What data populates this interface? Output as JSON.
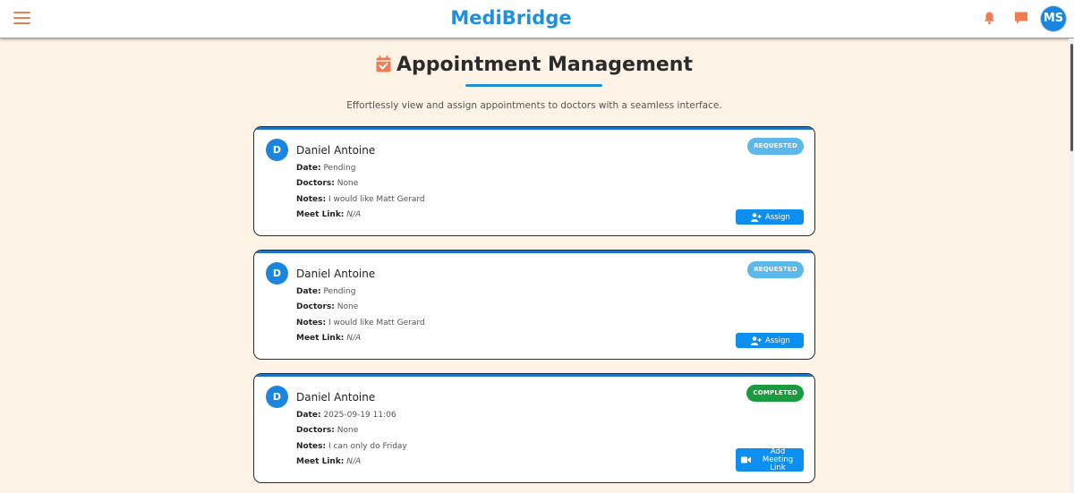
{
  "header": {
    "brand": "MediBridge",
    "user_initials": "MS",
    "icons": {
      "menu": "hamburger-menu-icon",
      "notifications": "bell-icon",
      "messages": "chat-bubble-icon"
    },
    "brand_color": "#1f8fe0",
    "accent_color": "#f07d52"
  },
  "page": {
    "title": "Appointment Management",
    "title_icon": "calendar-check-icon",
    "subtitle": "Effortlessly view and assign appointments to doctors with a seamless interface."
  },
  "labels": {
    "date": "Date:",
    "doctors": "Doctors:",
    "notes": "Notes:",
    "meet_link": "Meet Link:"
  },
  "appointments": [
    {
      "initial": "D",
      "patient": "Daniel Antoine",
      "status": "REQUESTED",
      "date": "Pending",
      "doctors": "None",
      "notes": "I would like Matt Gerard",
      "meet_link": "N/A",
      "action": "Assign"
    },
    {
      "initial": "D",
      "patient": "Daniel Antoine",
      "status": "REQUESTED",
      "date": "Pending",
      "doctors": "None",
      "notes": "I would like Matt Gerard",
      "meet_link": "N/A",
      "action": "Assign"
    },
    {
      "initial": "D",
      "patient": "Daniel Antoine",
      "status": "COMPLETED",
      "date": "2025-09-19 11:06",
      "doctors": "None",
      "notes": "I can only do Friday",
      "meet_link": "N/A",
      "action_line1": "Add Meeting",
      "action_line2": "Link"
    }
  ],
  "colors": {
    "requested": "#5ab9ea",
    "completed": "#1a9b3e",
    "button": "#0d8ff0",
    "background": "#fdf3e6"
  }
}
